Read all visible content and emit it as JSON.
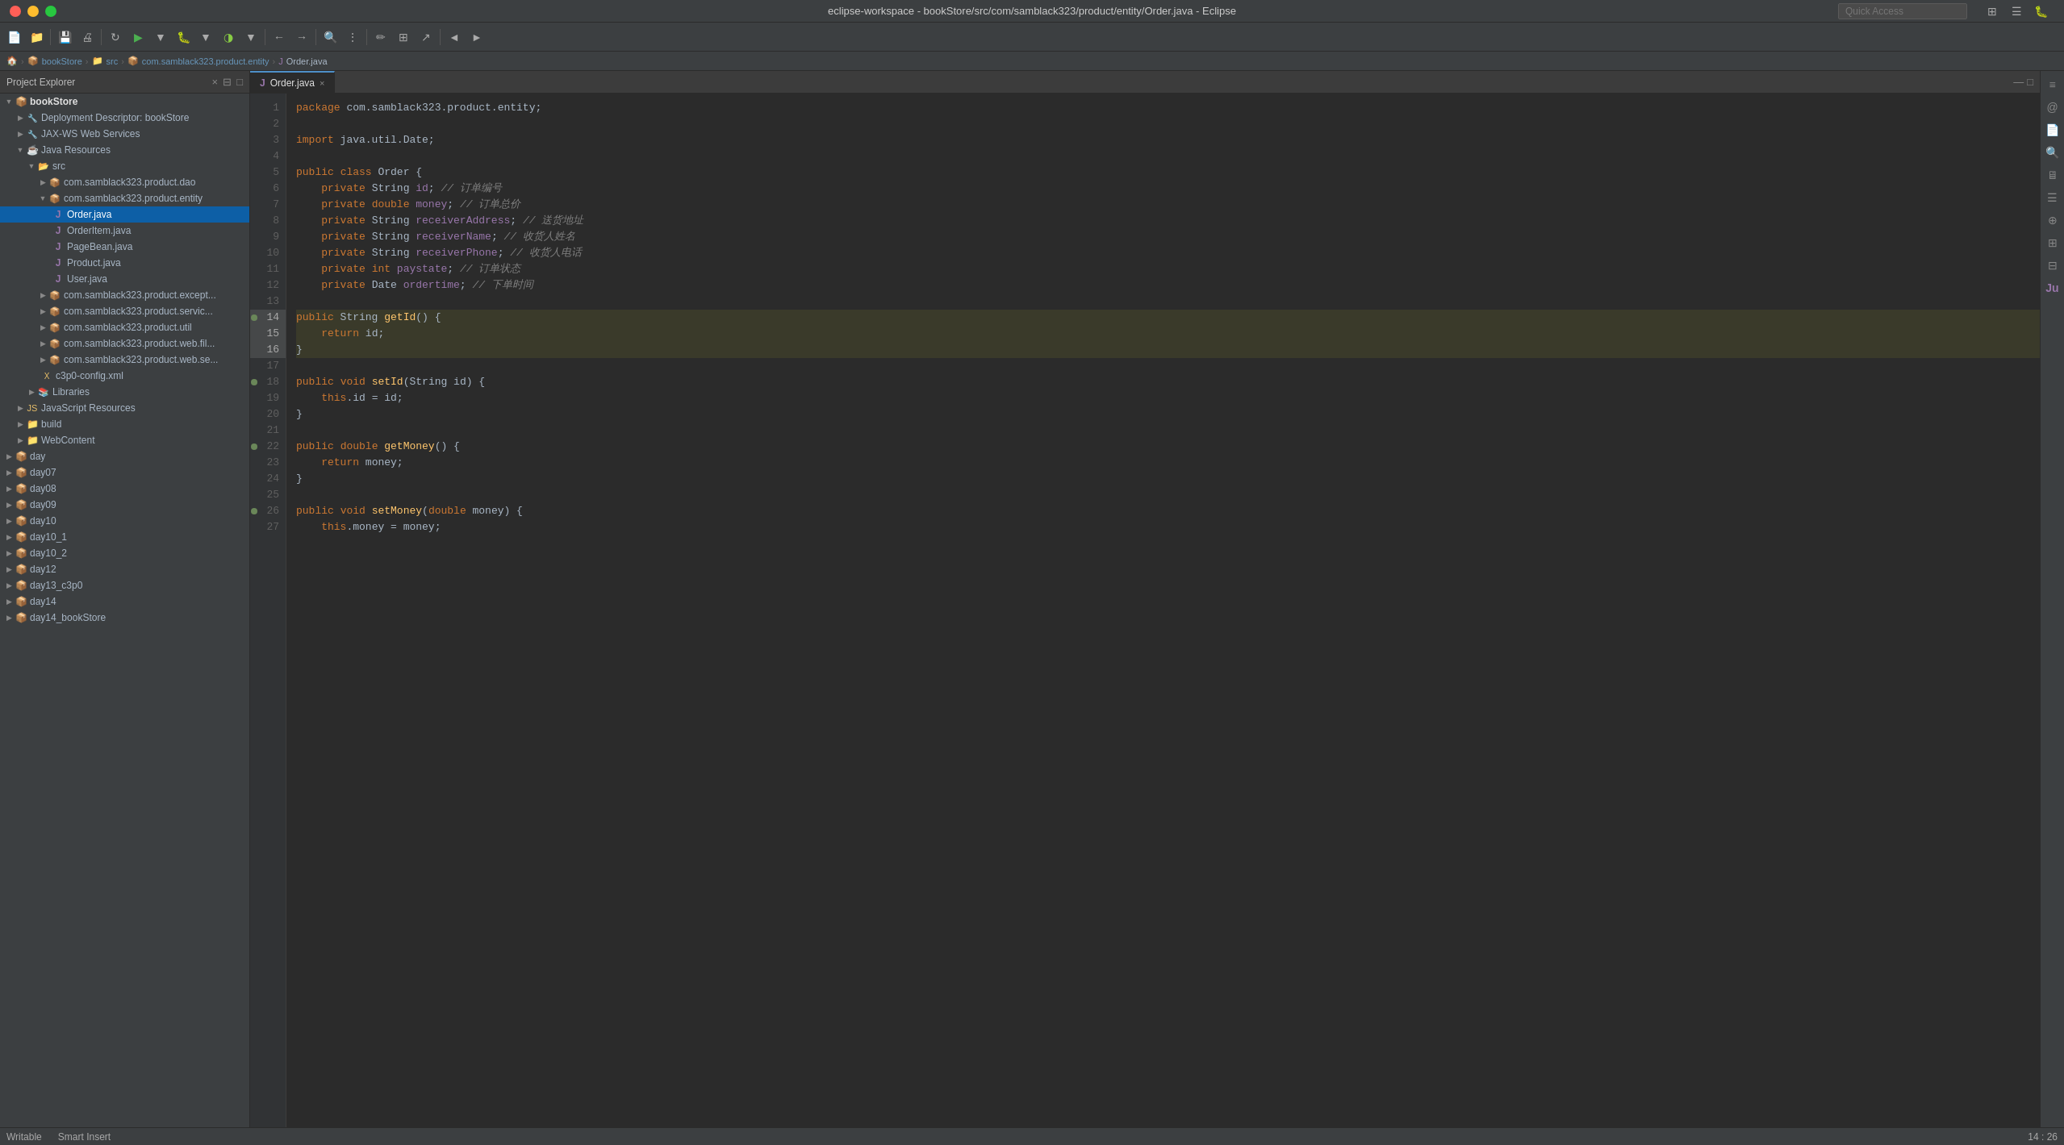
{
  "titlebar": {
    "title": "eclipse-workspace - bookStore/src/com/samblack323/product/entity/Order.java - Eclipse",
    "quick_access_placeholder": "Quick Access"
  },
  "breadcrumb": {
    "items": [
      "bookStore",
      "src",
      "com.samblack323.product.entity",
      "Order.java"
    ]
  },
  "project_explorer": {
    "title": "Project Explorer",
    "tree": [
      {
        "label": "bookStore",
        "level": 0,
        "type": "project",
        "expanded": true
      },
      {
        "label": "Deployment Descriptor: bookStore",
        "level": 1,
        "type": "folder",
        "expanded": false
      },
      {
        "label": "JAX-WS Web Services",
        "level": 1,
        "type": "folder",
        "expanded": false
      },
      {
        "label": "Java Resources",
        "level": 1,
        "type": "folder",
        "expanded": true
      },
      {
        "label": "src",
        "level": 2,
        "type": "src",
        "expanded": true
      },
      {
        "label": "com.samblack323.product.dao",
        "level": 3,
        "type": "package",
        "expanded": false
      },
      {
        "label": "com.samblack323.product.entity",
        "level": 3,
        "type": "package",
        "expanded": true
      },
      {
        "label": "Order.java",
        "level": 4,
        "type": "java",
        "selected": true
      },
      {
        "label": "OrderItem.java",
        "level": 4,
        "type": "java"
      },
      {
        "label": "PageBean.java",
        "level": 4,
        "type": "java"
      },
      {
        "label": "Product.java",
        "level": 4,
        "type": "java"
      },
      {
        "label": "User.java",
        "level": 4,
        "type": "java"
      },
      {
        "label": "com.samblack323.product.except...",
        "level": 3,
        "type": "package",
        "expanded": false
      },
      {
        "label": "com.samblack323.product.servic...",
        "level": 3,
        "type": "package",
        "expanded": false
      },
      {
        "label": "com.samblack323.product.util",
        "level": 3,
        "type": "package",
        "expanded": false
      },
      {
        "label": "com.samblack323.product.web.fil...",
        "level": 3,
        "type": "package",
        "expanded": false
      },
      {
        "label": "com.samblack323.product.web.se...",
        "level": 3,
        "type": "package",
        "expanded": false
      },
      {
        "label": "c3p0-config.xml",
        "level": 3,
        "type": "xml"
      },
      {
        "label": "Libraries",
        "level": 2,
        "type": "lib",
        "expanded": false
      },
      {
        "label": "JavaScript Resources",
        "level": 1,
        "type": "folder",
        "expanded": false
      },
      {
        "label": "build",
        "level": 1,
        "type": "folder",
        "expanded": false
      },
      {
        "label": "WebContent",
        "level": 1,
        "type": "folder",
        "expanded": false
      },
      {
        "label": "day",
        "level": 0,
        "type": "project"
      },
      {
        "label": "day07",
        "level": 0,
        "type": "project"
      },
      {
        "label": "day08",
        "level": 0,
        "type": "project"
      },
      {
        "label": "day09",
        "level": 0,
        "type": "project"
      },
      {
        "label": "day10",
        "level": 0,
        "type": "project"
      },
      {
        "label": "day10_1",
        "level": 0,
        "type": "project"
      },
      {
        "label": "day10_2",
        "level": 0,
        "type": "project"
      },
      {
        "label": "day12",
        "level": 0,
        "type": "project"
      },
      {
        "label": "day13_c3p0",
        "level": 0,
        "type": "project"
      },
      {
        "label": "day14",
        "level": 0,
        "type": "project"
      },
      {
        "label": "day14_bookStore",
        "level": 0,
        "type": "project"
      }
    ]
  },
  "editor": {
    "tab_label": "Order.java",
    "lines": [
      {
        "num": 1,
        "code": "package com.samblack323.product.entity;"
      },
      {
        "num": 2,
        "code": ""
      },
      {
        "num": 3,
        "code": "import java.util.Date;"
      },
      {
        "num": 4,
        "code": ""
      },
      {
        "num": 5,
        "code": "public class Order {"
      },
      {
        "num": 6,
        "code": "    private String id; // 订单编号"
      },
      {
        "num": 7,
        "code": "    private double money; // 订单总价"
      },
      {
        "num": 8,
        "code": "    private String receiverAddress; // 送货地址"
      },
      {
        "num": 9,
        "code": "    private String receiverName; // 收货人姓名"
      },
      {
        "num": 10,
        "code": "    private String receiverPhone; // 收货人电话"
      },
      {
        "num": 11,
        "code": "    private int paystate; // 订单状态"
      },
      {
        "num": 12,
        "code": "    private Date ordertime; // 下单时间"
      },
      {
        "num": 13,
        "code": ""
      },
      {
        "num": 14,
        "code": "public String getId() {",
        "highlighted": true,
        "marker": "method"
      },
      {
        "num": 15,
        "code": "    return id;",
        "highlighted": true
      },
      {
        "num": 16,
        "code": "}",
        "highlighted": true
      },
      {
        "num": 17,
        "code": ""
      },
      {
        "num": 18,
        "code": "public void setId(String id) {",
        "marker": "method"
      },
      {
        "num": 19,
        "code": "    this.id = id;"
      },
      {
        "num": 20,
        "code": "}"
      },
      {
        "num": 21,
        "code": ""
      },
      {
        "num": 22,
        "code": "public double getMoney() {",
        "marker": "method"
      },
      {
        "num": 23,
        "code": "    return money;"
      },
      {
        "num": 24,
        "code": "}"
      },
      {
        "num": 25,
        "code": ""
      },
      {
        "num": 26,
        "code": "public void setMoney(double money) {",
        "marker": "method"
      },
      {
        "num": 27,
        "code": "    this.money = money;"
      }
    ]
  },
  "statusbar": {
    "writable": "Writable",
    "insert_mode": "Smart Insert",
    "position": "14 : 26"
  }
}
